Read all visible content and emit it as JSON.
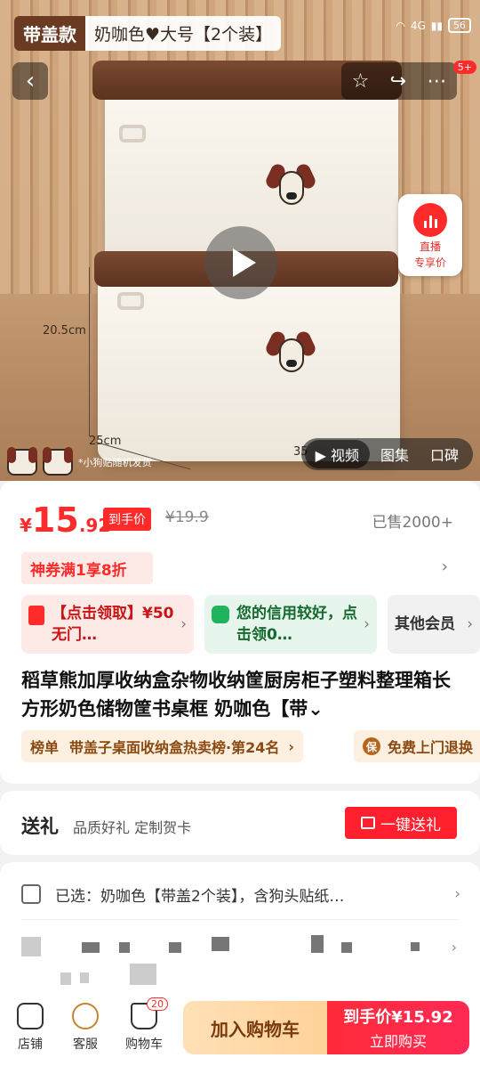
{
  "hero": {
    "brand_badge": "带盖款",
    "variant_label": "奶咖色♥大号【2个装】",
    "dimension_height": "20.5cm",
    "dimension_width": "25cm",
    "dimension_depth": "35",
    "sticker_note": "*小狗贴随机发货",
    "live": {
      "line1": "直播",
      "line2": "专享价"
    },
    "media_tabs": [
      "视频",
      "图集",
      "口碑"
    ],
    "active_tab": "视频",
    "message_badge": "5+"
  },
  "status": {
    "network": "4G",
    "battery": "56"
  },
  "price": {
    "currency": "¥",
    "integer": "15",
    "decimal": ".92",
    "tag": "到手价",
    "original": "¥19.9",
    "sold": "已售2000+"
  },
  "coupon": {
    "label": "神券满1享8折"
  },
  "offers": [
    {
      "text": "【点击领取】¥50无门…",
      "icon": "coupon-icon"
    },
    {
      "text": "您的信用较好，点击领0…",
      "icon": "credit-icon"
    },
    {
      "text": "其他会员"
    }
  ],
  "product": {
    "title": "稻草熊加厚收纳盒杂物收纳筐厨房柜子塑料整理箱长方形奶色储物筐书桌框 奶咖色【带⌄"
  },
  "rank": {
    "key": "榜单",
    "text": "带盖子桌面收纳盒热卖榜·第24名"
  },
  "service": {
    "icon_text": "保",
    "text": "免费上门退换"
  },
  "gift": {
    "title": "送礼",
    "subtitle": "品质好礼 定制贺卡",
    "button": "一键送礼"
  },
  "selected": {
    "text": "已选：奶咖色【带盖2个装】，含狗头贴纸…"
  },
  "bottom_bar": {
    "store": "店铺",
    "service": "客服",
    "cart": "购物车",
    "cart_count": "20",
    "add_cart": "加入购物车",
    "buy_price": "到手价¥15.92",
    "buy_now": "立即购买"
  },
  "colors": {
    "accent": "#ff2a2a",
    "lid": "#5b331f",
    "rank_bg": "#fdf0e0"
  }
}
